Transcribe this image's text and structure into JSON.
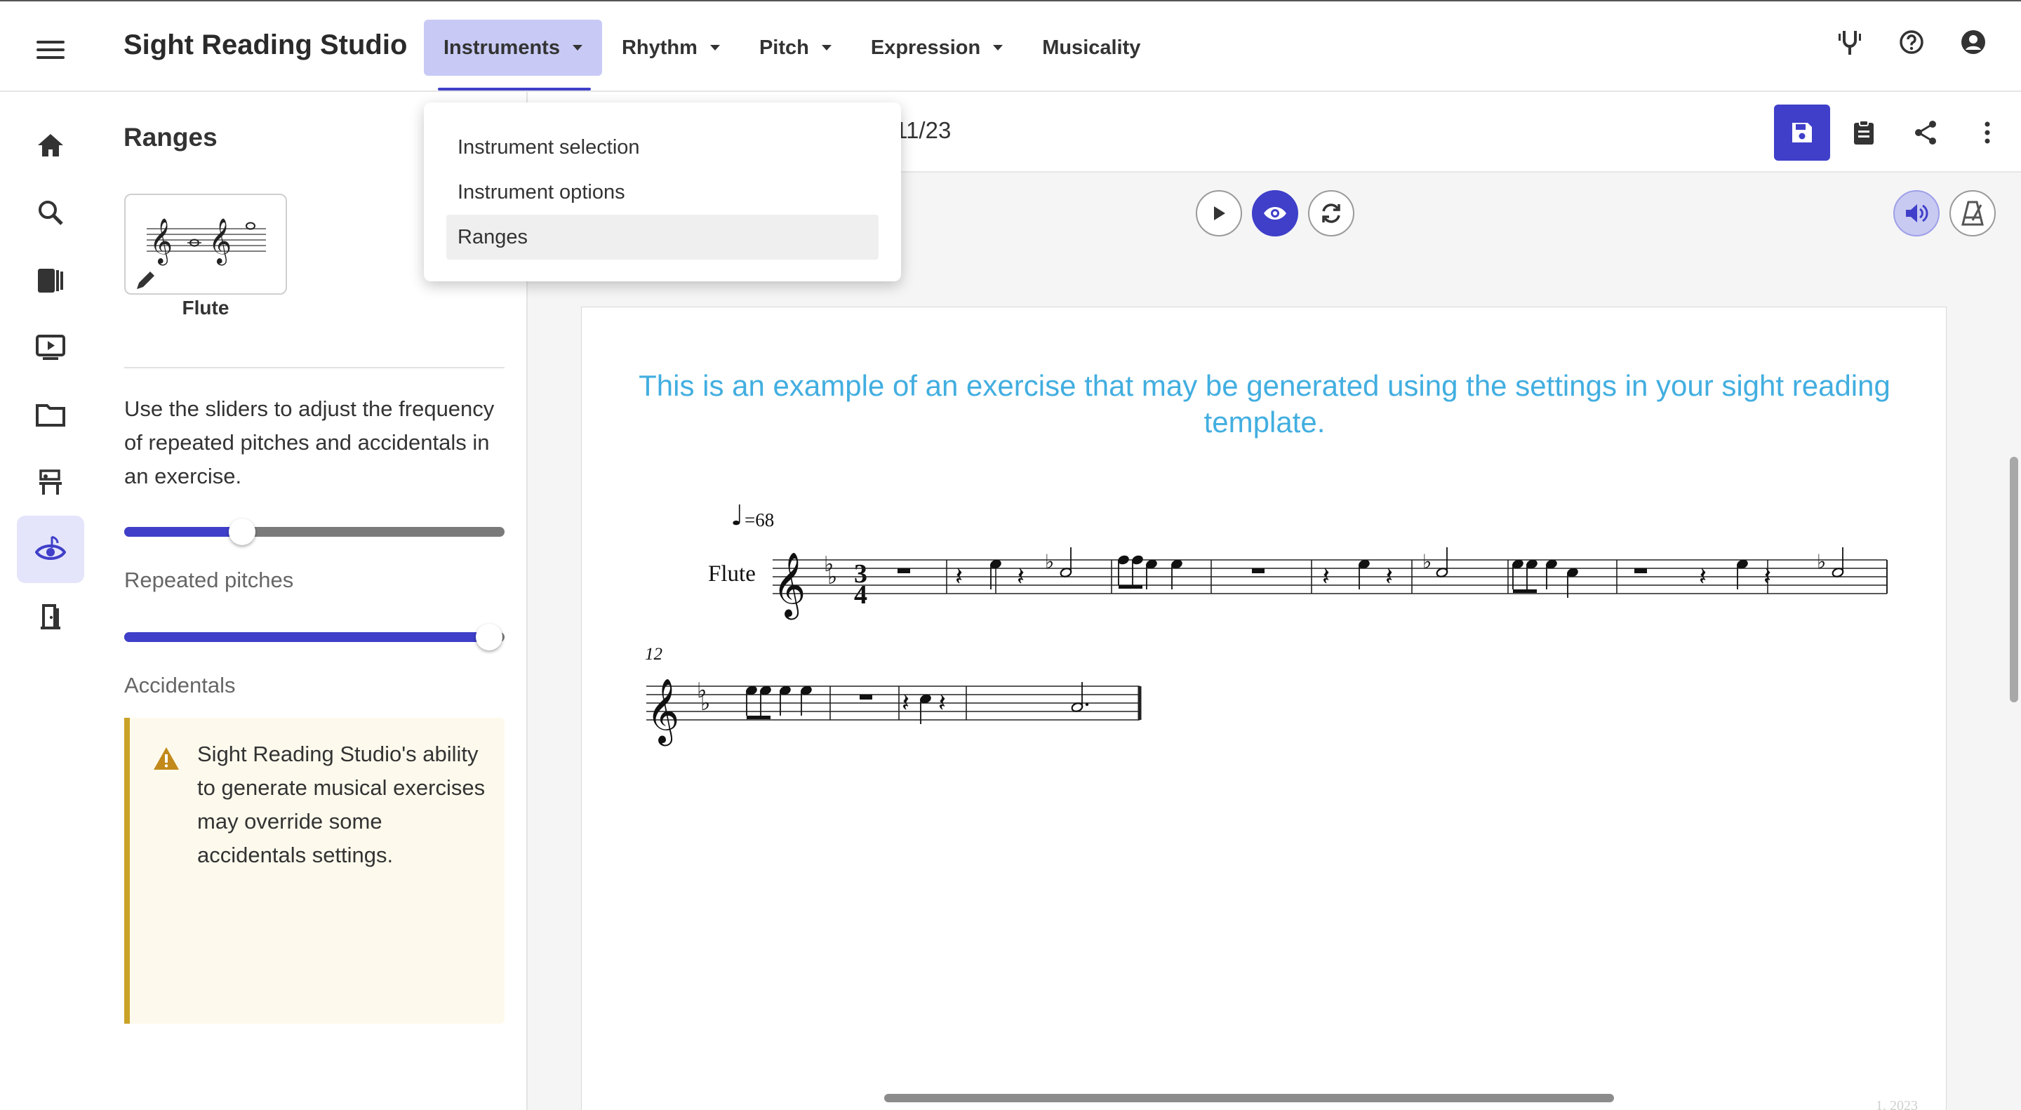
{
  "app": {
    "title": "Sight Reading Studio",
    "accent_color": "#3f3fc9"
  },
  "topnav": {
    "items": [
      {
        "label": "Instruments",
        "has_caret": true,
        "active": true
      },
      {
        "label": "Rhythm",
        "has_caret": true
      },
      {
        "label": "Pitch",
        "has_caret": true
      },
      {
        "label": "Expression",
        "has_caret": true
      },
      {
        "label": "Musicality",
        "has_caret": false
      }
    ],
    "right_icons": [
      "tuning-fork-icon",
      "help-icon",
      "account-icon"
    ]
  },
  "sidebar": {
    "items": [
      {
        "icon": "home-icon"
      },
      {
        "icon": "search-icon"
      },
      {
        "icon": "library-icon"
      },
      {
        "icon": "video-icon"
      },
      {
        "icon": "folder-icon"
      },
      {
        "icon": "assignments-icon"
      },
      {
        "icon": "sight-reading-icon",
        "active": true
      },
      {
        "icon": "exit-icon"
      }
    ]
  },
  "dropdown": {
    "items": [
      {
        "label": "Instrument selection"
      },
      {
        "label": "Instrument options"
      },
      {
        "label": "Ranges",
        "selected": true
      }
    ]
  },
  "panel": {
    "title": "Ranges",
    "instrument_name": "Flute",
    "description": "Use the sliders to adjust the frequency of repeated pitches and accidentals in an exercise.",
    "sliders": [
      {
        "label": "Repeated pitches",
        "value": 0.31
      },
      {
        "label": "Accidentals",
        "value": 0.96
      }
    ],
    "warning": "Sight Reading Studio's ability to generate musical exercises may override some accidentals settings."
  },
  "exercise": {
    "date_fragment": "/11/23",
    "actions": [
      "save-icon",
      "clipboard-icon",
      "share-icon",
      "more-vert-icon"
    ],
    "playback": [
      "play-icon",
      "eye-icon",
      "refresh-icon"
    ],
    "toggles": [
      "volume-icon",
      "metronome-icon"
    ],
    "caption": "This is an example of an exercise that may be generated using the settings in your sight reading template.",
    "tempo": "=68",
    "instrument_label": "Flute",
    "time_signature_top": "3",
    "time_signature_bottom": "4",
    "measure_number": "12",
    "footer_fragment": "1, 2023"
  }
}
